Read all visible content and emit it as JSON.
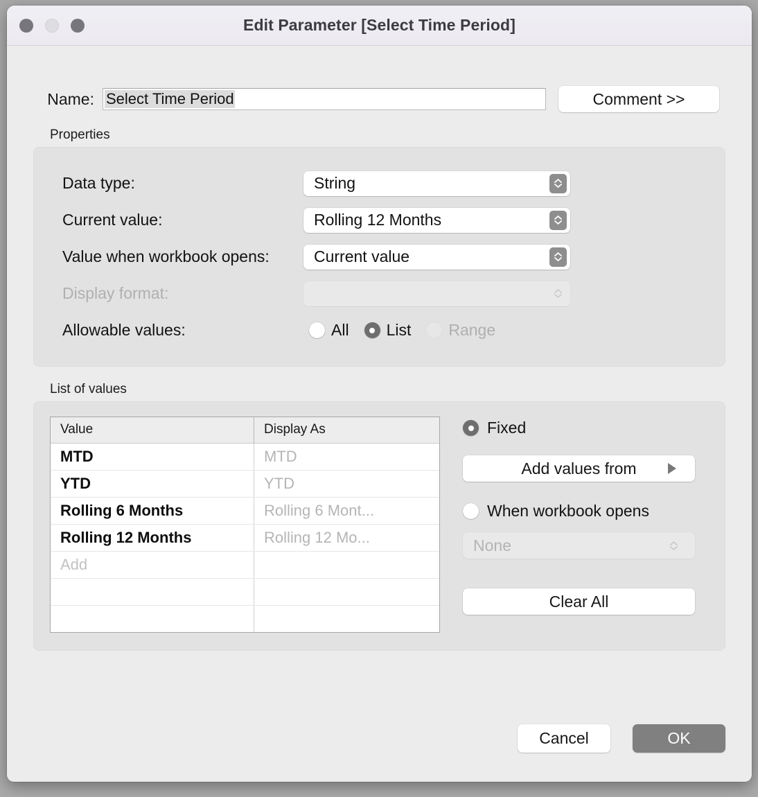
{
  "window": {
    "title": "Edit Parameter [Select Time Period]",
    "traffic_lights": [
      "close-button",
      "minimize-button",
      "maximize-button"
    ]
  },
  "name_row": {
    "label": "Name:",
    "value": "Select Time Period",
    "comment_button": "Comment >>"
  },
  "properties": {
    "group_label": "Properties",
    "rows": [
      {
        "label": "Data type:",
        "value": "String",
        "disabled": false
      },
      {
        "label": "Current value:",
        "value": "Rolling 12 Months",
        "disabled": false
      },
      {
        "label": "Value when workbook opens:",
        "value": "Current value",
        "disabled": false
      },
      {
        "label": "Display format:",
        "value": "",
        "disabled": true
      }
    ],
    "allowable": {
      "label": "Allowable values:",
      "options": [
        {
          "label": "All",
          "checked": false,
          "disabled": false
        },
        {
          "label": "List",
          "checked": true,
          "disabled": false
        },
        {
          "label": "Range",
          "checked": false,
          "disabled": true
        }
      ]
    }
  },
  "list_of_values": {
    "group_label": "List of values",
    "columns": [
      "Value",
      "Display As"
    ],
    "rows": [
      {
        "value": "MTD",
        "display_as": "MTD",
        "placeholder": false
      },
      {
        "value": "YTD",
        "display_as": "YTD",
        "placeholder": false
      },
      {
        "value": "Rolling 6 Months",
        "display_as": "Rolling 6 Mont...",
        "placeholder": false
      },
      {
        "value": "Rolling 12 Months",
        "display_as": "Rolling 12 Mo...",
        "placeholder": false
      },
      {
        "value": "Add",
        "display_as": "",
        "placeholder": true
      },
      {
        "value": "",
        "display_as": "",
        "placeholder": true
      },
      {
        "value": "",
        "display_as": "",
        "placeholder": true
      }
    ],
    "side": {
      "fixed_label": "Fixed",
      "fixed_checked": true,
      "add_values_from": "Add values from",
      "when_workbook_opens_label": "When workbook opens",
      "when_workbook_opens_checked": false,
      "when_workbook_opens_value": "None",
      "clear_all": "Clear All"
    }
  },
  "footer": {
    "cancel": "Cancel",
    "ok": "OK"
  },
  "colors": {
    "dialog_bg": "#ececec",
    "group_bg": "#e2e2e2",
    "titlebar_bg": "#eeedf2",
    "accent_selected": "#6e6e6e",
    "default_button_bg": "#808080",
    "disabled_text": "#b0b0b0"
  }
}
